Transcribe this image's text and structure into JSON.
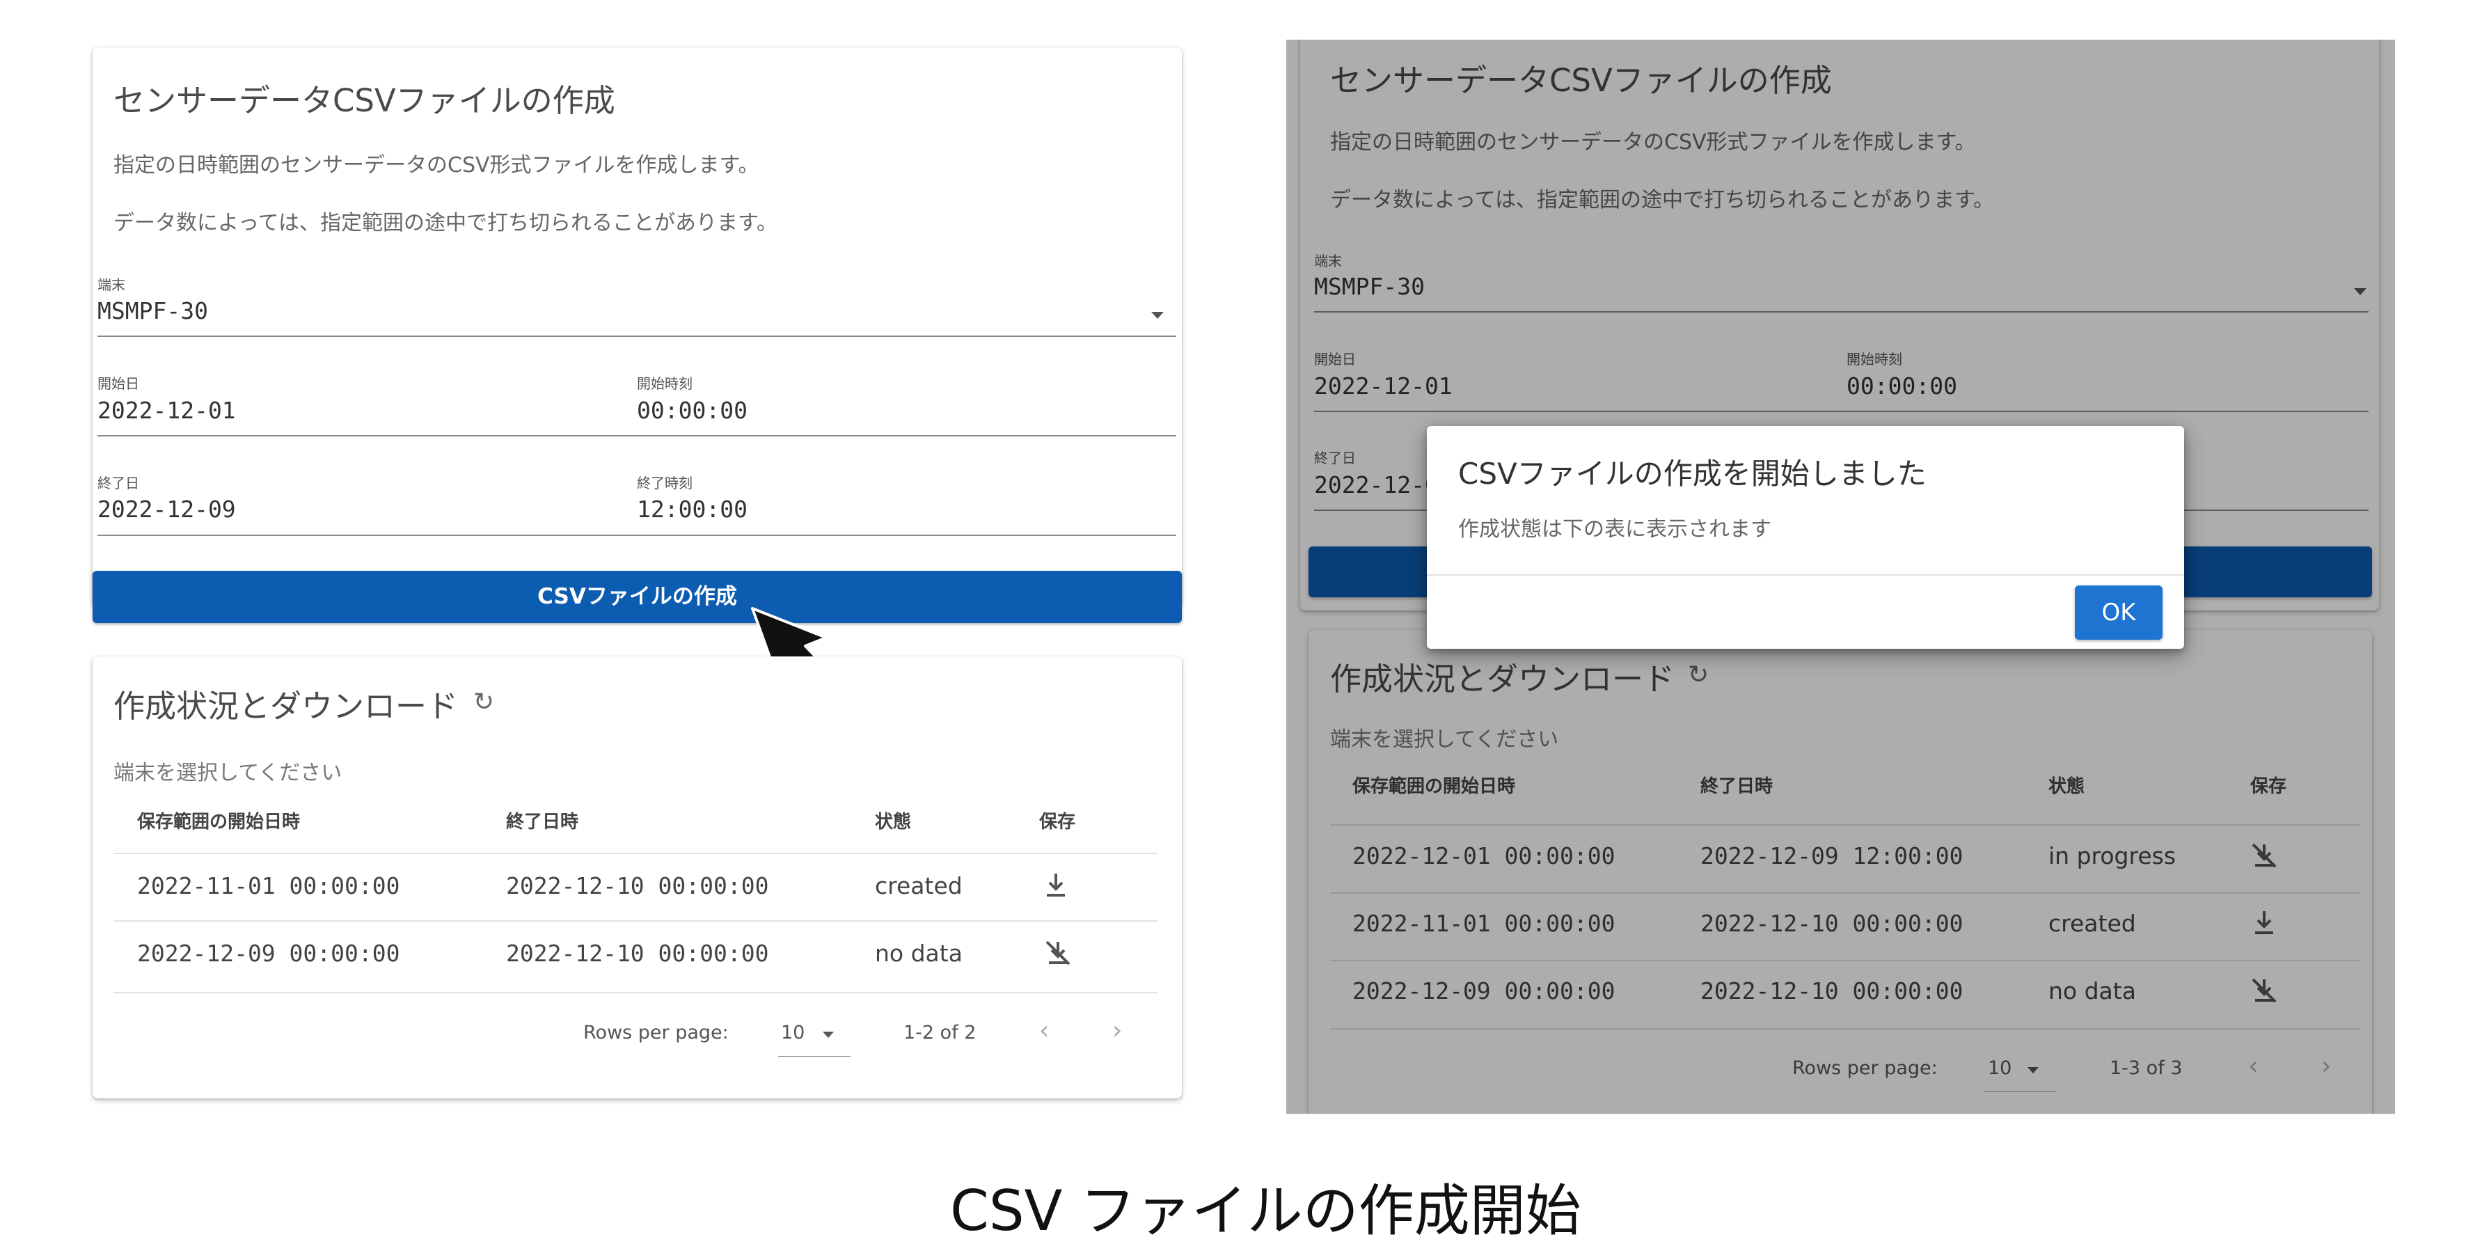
{
  "left": {
    "form": {
      "title": "センサーデータCSVファイルの作成",
      "desc1": "指定の日時範囲のセンサーデータのCSV形式ファイルを作成します。",
      "desc2": "データ数によっては、指定範囲の途中で打ち切られることがあります。",
      "device_label": "端末",
      "device_value": "MSMPF-30",
      "start_date_label": "開始日",
      "start_date": "2022-12-01",
      "start_time_label": "開始時刻",
      "start_time": "00:00:00",
      "end_date_label": "終了日",
      "end_date": "2022-12-09",
      "end_time_label": "終了時刻",
      "end_time": "12:00:00",
      "button_label": "CSVファイルの作成"
    },
    "status": {
      "title": "作成状況とダウンロード",
      "hint": "端末を選択してください",
      "headers": [
        "保存範囲の開始日時",
        "終了日時",
        "状態",
        "保存"
      ],
      "rows": [
        {
          "start": "2022-11-01 00:00:00",
          "end": "2022-12-10 00:00:00",
          "state": "created",
          "save_icon": "download-icon"
        },
        {
          "start": "2022-12-09 00:00:00",
          "end": "2022-12-10 00:00:00",
          "state": "no data",
          "save_icon": "download-off-icon"
        }
      ],
      "rows_per_page_label": "Rows per page:",
      "rows_per_page": "10",
      "range": "1-2 of 2"
    }
  },
  "right": {
    "form": {
      "title": "センサーデータCSVファイルの作成",
      "desc1": "指定の日時範囲のセンサーデータのCSV形式ファイルを作成します。",
      "desc2": "データ数によっては、指定範囲の途中で打ち切られることがあります。",
      "device_label": "端末",
      "device_value": "MSMPF-30",
      "start_date_label": "開始日",
      "start_date": "2022-12-01",
      "start_time_label": "開始時刻",
      "start_time": "00:00:00",
      "end_date_label": "終了日",
      "end_date_partial": "2022-12-0"
    },
    "dialog": {
      "title": "CSVファイルの作成を開始しました",
      "message": "作成状態は下の表に表示されます",
      "ok_label": "OK"
    },
    "status": {
      "title": "作成状況とダウンロード",
      "hint": "端末を選択してください",
      "headers": [
        "保存範囲の開始日時",
        "終了日時",
        "状態",
        "保存"
      ],
      "rows": [
        {
          "start": "2022-12-01 00:00:00",
          "end": "2022-12-09 12:00:00",
          "state": "in progress",
          "save_icon": "download-off-icon"
        },
        {
          "start": "2022-11-01 00:00:00",
          "end": "2022-12-10 00:00:00",
          "state": "created",
          "save_icon": "download-icon"
        },
        {
          "start": "2022-12-09 00:00:00",
          "end": "2022-12-10 00:00:00",
          "state": "no data",
          "save_icon": "download-off-icon"
        }
      ],
      "rows_per_page_label": "Rows per page:",
      "rows_per_page": "10",
      "range": "1-3 of 3"
    }
  },
  "caption": "CSV ファイルの作成開始",
  "colors": {
    "primary": "#0c5cb1",
    "ok_button": "#1e74d0",
    "overlay": "rgba(0,0,0,0.32)"
  }
}
